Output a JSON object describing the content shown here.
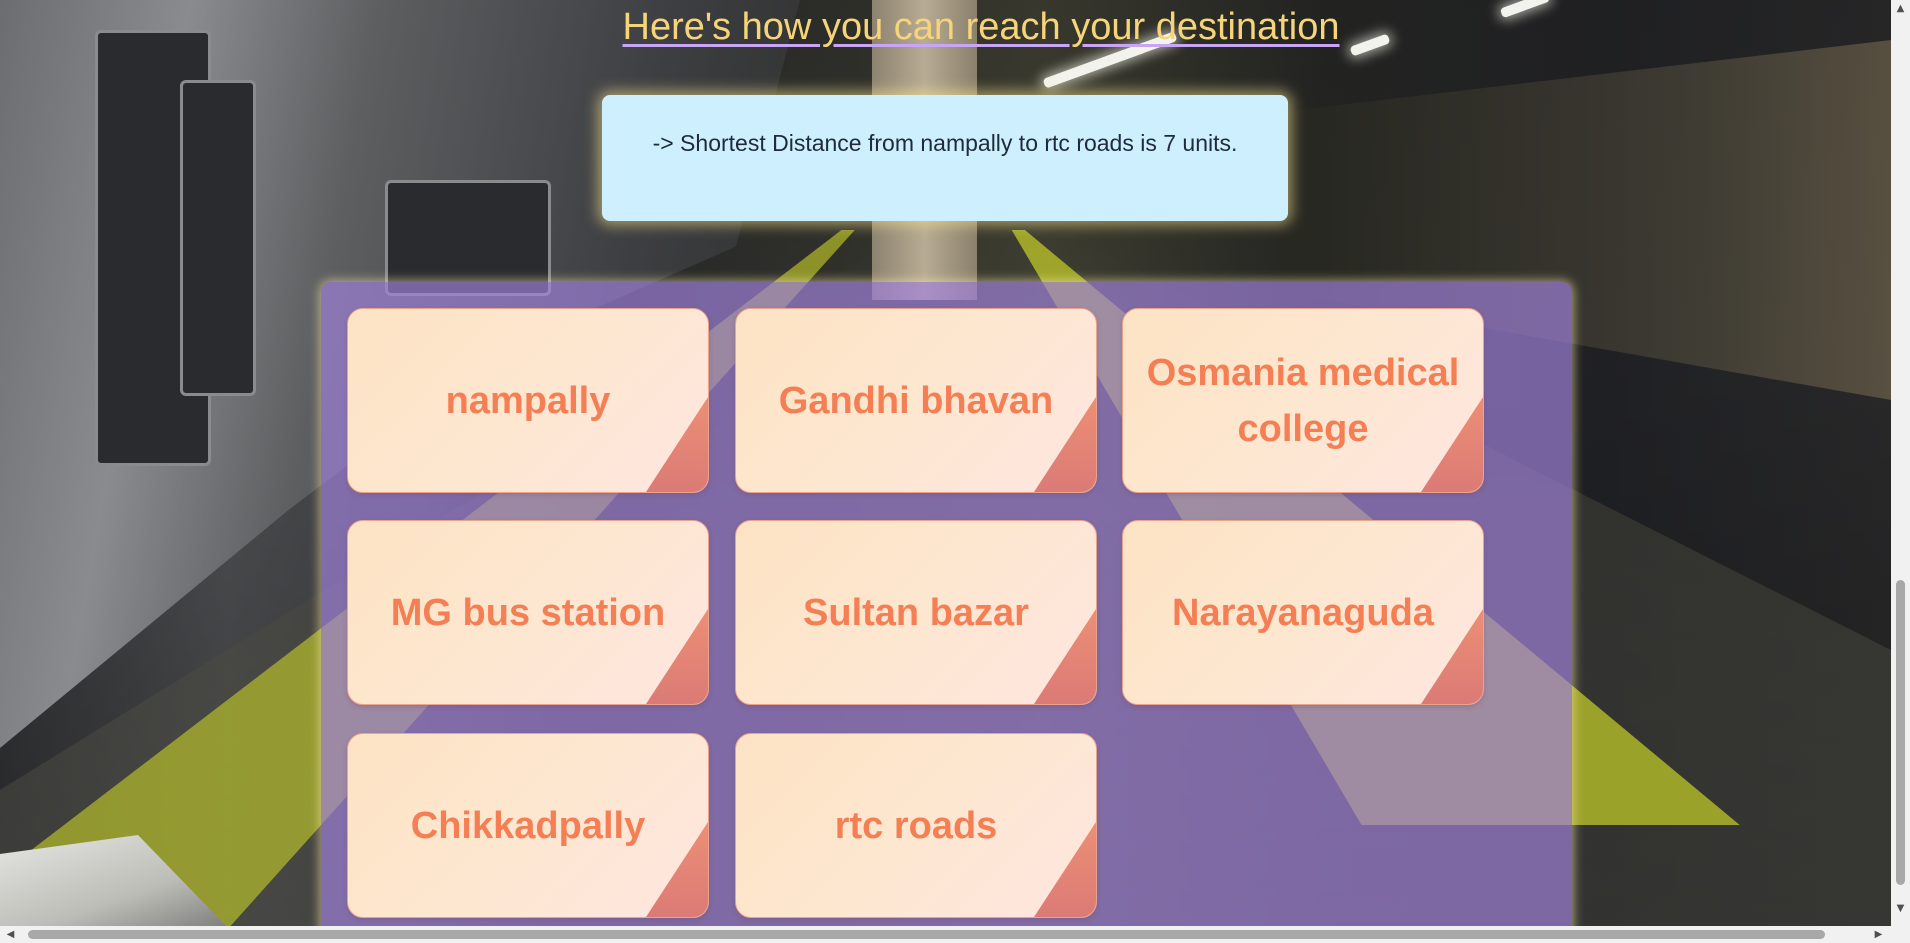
{
  "heading": "Here's how you can reach your destination",
  "result": {
    "text": "-> Shortest Distance from nampally to rtc roads is 7 units."
  },
  "stations": [
    "nampally",
    "Gandhi bhavan",
    "Osmania medical college",
    "MG bus station",
    "Sultan bazar",
    "Narayanaguda",
    "Chikkadpally",
    "rtc roads"
  ],
  "scrollbar": {
    "up_arrow": "▲",
    "down_arrow": "▼",
    "left_arrow": "◀",
    "right_arrow": "▶"
  },
  "colors": {
    "heading": "#f6d47a",
    "heading_underline": "#c9a6f5",
    "result_bg": "#cdeffe",
    "panel_bg": "#a082dc",
    "card_text": "#f57f54",
    "card_corner": "#e07a70"
  }
}
